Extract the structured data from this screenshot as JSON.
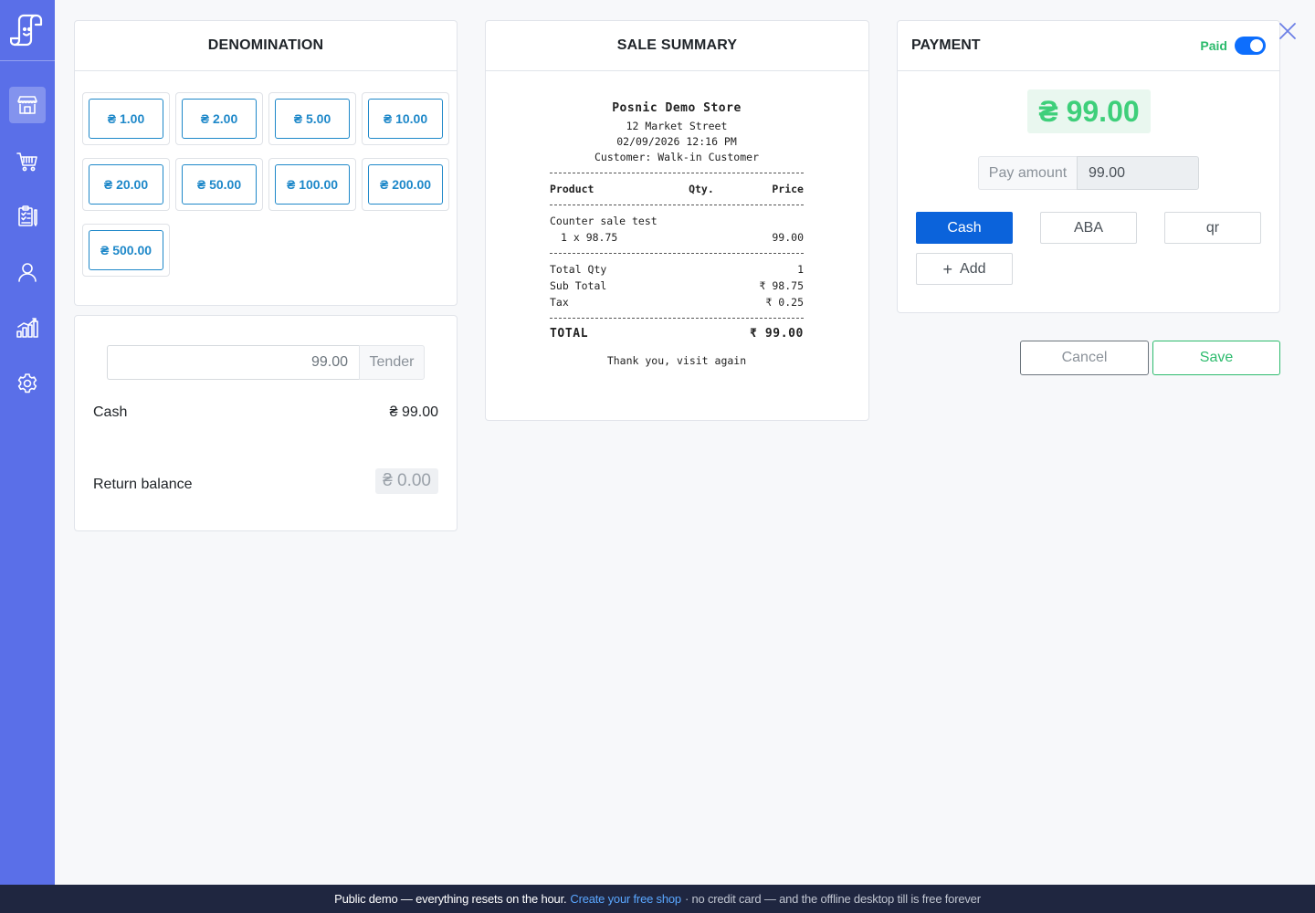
{
  "sidebar": {
    "items": [
      {
        "name": "store-icon",
        "active": true
      },
      {
        "name": "cart-icon",
        "active": false
      },
      {
        "name": "clipboard-icon",
        "active": false
      },
      {
        "name": "user-icon",
        "active": false
      },
      {
        "name": "chart-icon",
        "active": false
      },
      {
        "name": "gear-icon",
        "active": false
      }
    ]
  },
  "denomination": {
    "title": "DENOMINATION",
    "buttons": [
      "₴ 1.00",
      "₴ 2.00",
      "₴ 5.00",
      "₴ 10.00",
      "₴ 20.00",
      "₴ 50.00",
      "₴ 100.00",
      "₴ 200.00",
      "₴ 500.00"
    ]
  },
  "tender": {
    "value": "99.00",
    "addon": "Tender",
    "cash_label": "Cash",
    "cash_value": "₴ 99.00",
    "return_label": "Return balance",
    "return_value": "₴ 0.00"
  },
  "sale_summary": {
    "title": "SALE SUMMARY",
    "store": "Posnic Demo Store",
    "address": "12 Market Street",
    "datetime": "02/09/2026 12:16 PM",
    "customer": "Customer: Walk-in Customer",
    "col_product": "Product",
    "col_qty": "Qty.",
    "col_price": "Price",
    "item_name": "Counter sale test",
    "item_qty_line": "1 x 98.75",
    "item_price": "99.00",
    "total_qty_label": "Total Qty",
    "total_qty": "1",
    "subtotal_label": "Sub Total",
    "subtotal": "₹ 98.75",
    "tax_label": "Tax",
    "tax": "₹ 0.25",
    "total_label": "TOTAL",
    "total": "₹ 99.00",
    "thanks": "Thank you, visit again"
  },
  "payment": {
    "title": "PAYMENT",
    "paid_label": "Paid",
    "paid_on": true,
    "amount": "₴ 99.00",
    "pay_amount_label": "Pay amount",
    "pay_amount_value": "99.00",
    "methods": [
      "Cash",
      "ABA",
      "qr"
    ],
    "selected_method": "Cash",
    "add_label": "Add",
    "cancel_label": "Cancel",
    "save_label": "Save"
  },
  "banner": {
    "lead": "Public demo — everything resets on the hour.",
    "link": "Create your free shop",
    "tail": "· no credit card — and the offline desktop till is free forever"
  },
  "colors": {
    "sidebar": "#5a6fe8",
    "accent_blue": "#0b63db",
    "denom_blue": "#1e88c9",
    "success": "#2dbb6d",
    "banner_bg": "#1f2640"
  }
}
